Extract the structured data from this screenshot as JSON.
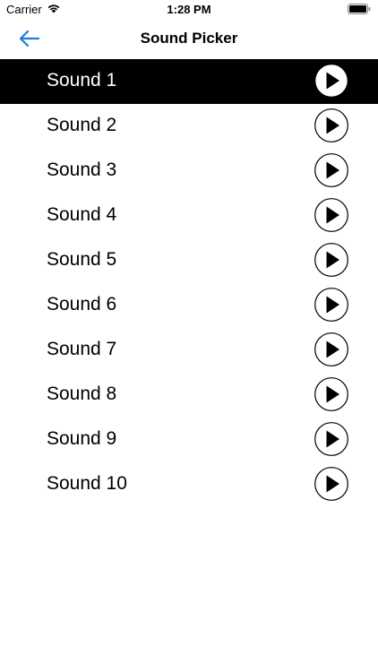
{
  "status": {
    "carrier": "Carrier",
    "time": "1:28 PM"
  },
  "nav": {
    "title": "Sound Picker"
  },
  "sounds": [
    {
      "label": "Sound 1",
      "selected": true
    },
    {
      "label": "Sound 2",
      "selected": false
    },
    {
      "label": "Sound 3",
      "selected": false
    },
    {
      "label": "Sound 4",
      "selected": false
    },
    {
      "label": "Sound 5",
      "selected": false
    },
    {
      "label": "Sound 6",
      "selected": false
    },
    {
      "label": "Sound 7",
      "selected": false
    },
    {
      "label": "Sound 8",
      "selected": false
    },
    {
      "label": "Sound 9",
      "selected": false
    },
    {
      "label": "Sound 10",
      "selected": false
    }
  ],
  "icons": {
    "back": "arrow-left-icon",
    "play": "play-icon",
    "wifi": "wifi-icon",
    "battery": "battery-icon"
  },
  "colors": {
    "accent": "#1a7fe0",
    "selected_bg": "#000000",
    "selected_text": "#ffffff"
  }
}
